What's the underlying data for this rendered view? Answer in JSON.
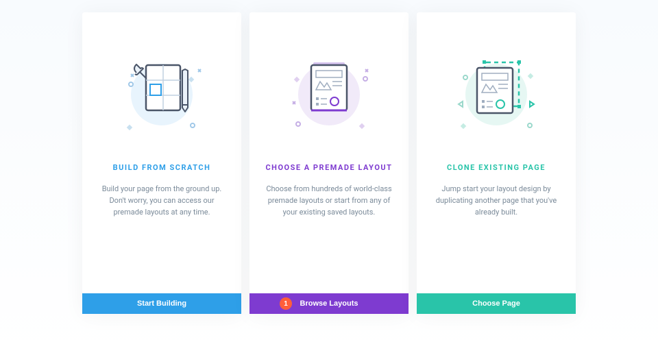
{
  "cards": [
    {
      "heading": "BUILD FROM SCRATCH",
      "description": "Build your page from the ground up. Don't worry, you can access our premade layouts at any time.",
      "button": "Start Building"
    },
    {
      "heading": "CHOOSE A PREMADE LAYOUT",
      "description": "Choose from hundreds of world-class premade layouts or start from any of your existing saved layouts.",
      "button": "Browse Layouts",
      "badge": "1"
    },
    {
      "heading": "CLONE EXISTING PAGE",
      "description": "Jump start your layout design by duplicating another page that you've already built.",
      "button": "Choose Page"
    }
  ]
}
